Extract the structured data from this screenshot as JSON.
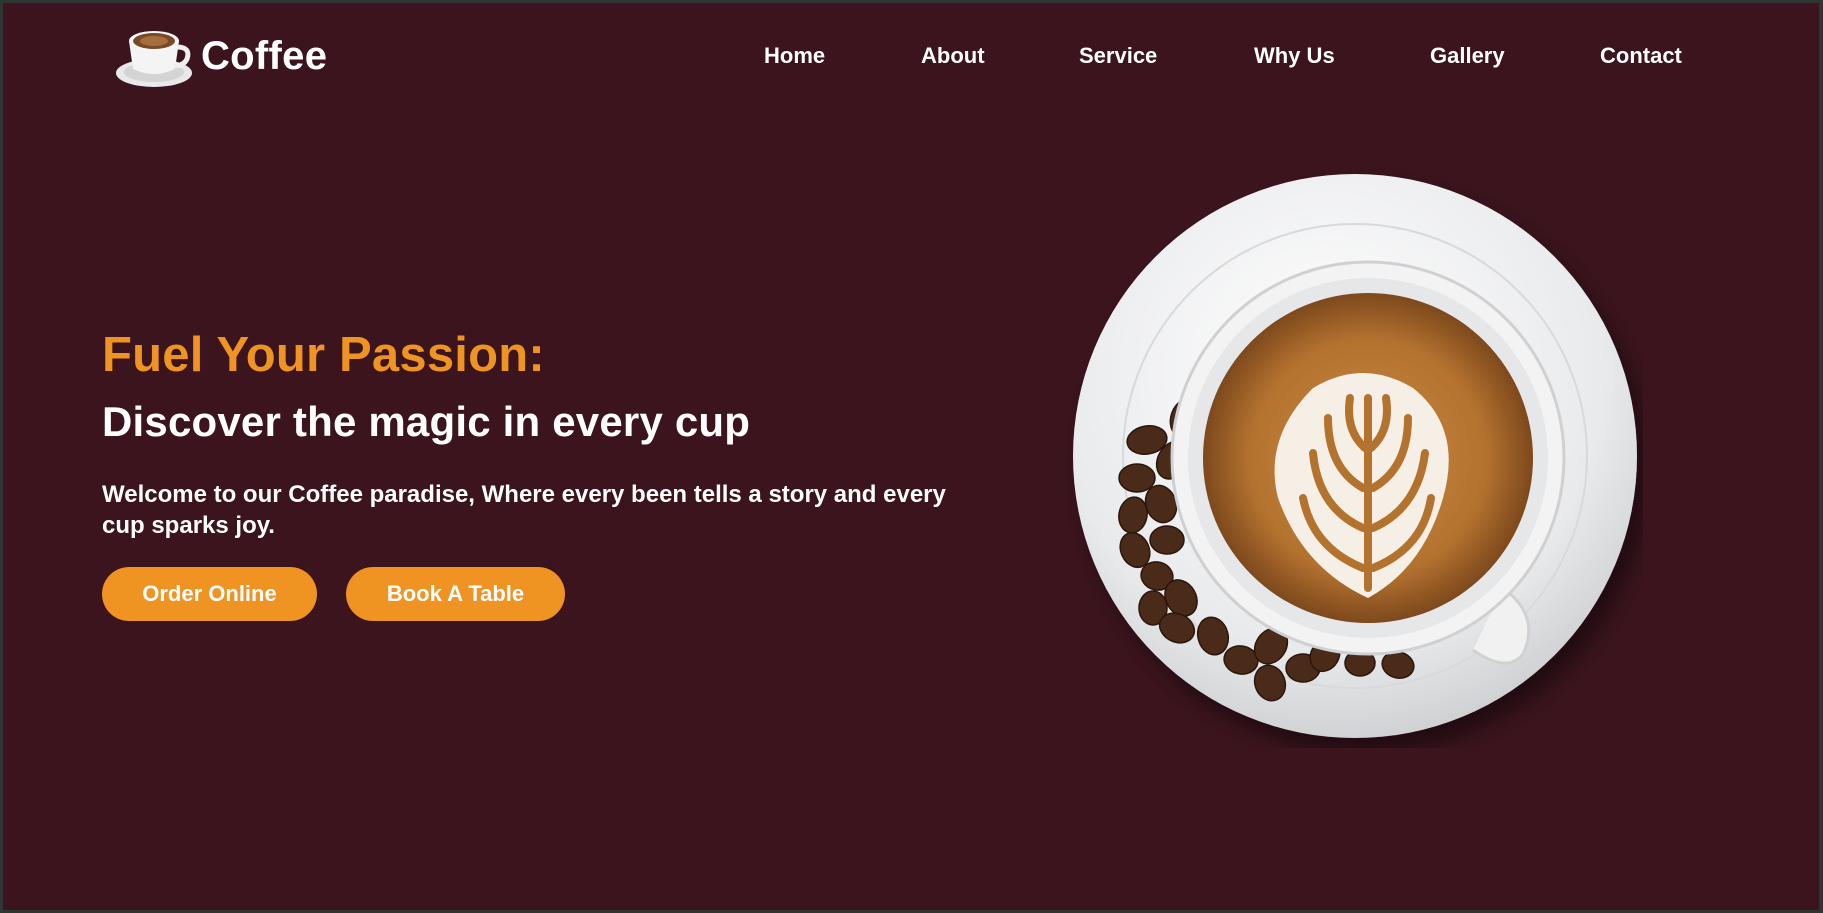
{
  "brand": {
    "name": "Coffee",
    "logo_icon": "coffee-cup-logo-icon"
  },
  "nav": {
    "items": [
      {
        "label": "Home"
      },
      {
        "label": "About"
      },
      {
        "label": "Service"
      },
      {
        "label": "Why Us"
      },
      {
        "label": "Gallery"
      },
      {
        "label": "Contact"
      }
    ]
  },
  "hero": {
    "title": "Fuel Your Passion:",
    "subtitle": "Discover the magic in every cup",
    "text": "Welcome to our Coffee paradise, Where every been tells a story and every cup sparks joy.",
    "buttons": {
      "order": "Order Online",
      "book": "Book A Table"
    },
    "image_icon": "latte-art-cup-image"
  },
  "colors": {
    "background": "#3b141d",
    "accent": "#ef9322",
    "text": "#ffffff",
    "outer_frame": "#2f3532"
  }
}
